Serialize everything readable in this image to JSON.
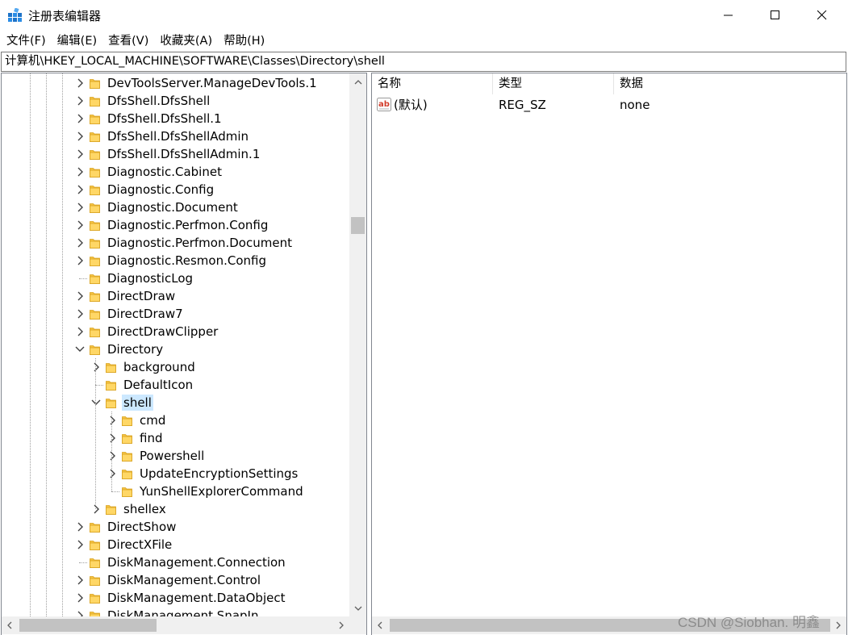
{
  "window": {
    "title": "注册表编辑器",
    "minimize_icon": "minimize-icon",
    "maximize_icon": "maximize-icon",
    "close_icon": "close-icon"
  },
  "menu": [
    {
      "label": "文件(F)"
    },
    {
      "label": "编辑(E)"
    },
    {
      "label": "查看(V)"
    },
    {
      "label": "收藏夹(A)"
    },
    {
      "label": "帮助(H)"
    }
  ],
  "address": "计算机\\HKEY_LOCAL_MACHINE\\SOFTWARE\\Classes\\Directory\\shell",
  "tree": [
    {
      "label": "DevToolsServer.ManageDevTools.1",
      "depth": 0,
      "expander": "collapsed"
    },
    {
      "label": "DfsShell.DfsShell",
      "depth": 0,
      "expander": "collapsed"
    },
    {
      "label": "DfsShell.DfsShell.1",
      "depth": 0,
      "expander": "collapsed"
    },
    {
      "label": "DfsShell.DfsShellAdmin",
      "depth": 0,
      "expander": "collapsed"
    },
    {
      "label": "DfsShell.DfsShellAdmin.1",
      "depth": 0,
      "expander": "collapsed"
    },
    {
      "label": "Diagnostic.Cabinet",
      "depth": 0,
      "expander": "collapsed"
    },
    {
      "label": "Diagnostic.Config",
      "depth": 0,
      "expander": "collapsed"
    },
    {
      "label": "Diagnostic.Document",
      "depth": 0,
      "expander": "collapsed"
    },
    {
      "label": "Diagnostic.Perfmon.Config",
      "depth": 0,
      "expander": "collapsed"
    },
    {
      "label": "Diagnostic.Perfmon.Document",
      "depth": 0,
      "expander": "collapsed"
    },
    {
      "label": "Diagnostic.Resmon.Config",
      "depth": 0,
      "expander": "collapsed"
    },
    {
      "label": "DiagnosticLog",
      "depth": 0,
      "expander": "none"
    },
    {
      "label": "DirectDraw",
      "depth": 0,
      "expander": "collapsed"
    },
    {
      "label": "DirectDraw7",
      "depth": 0,
      "expander": "collapsed"
    },
    {
      "label": "DirectDrawClipper",
      "depth": 0,
      "expander": "collapsed"
    },
    {
      "label": "Directory",
      "depth": 0,
      "expander": "expanded"
    },
    {
      "label": "background",
      "depth": 1,
      "expander": "collapsed"
    },
    {
      "label": "DefaultIcon",
      "depth": 1,
      "expander": "none"
    },
    {
      "label": "shell",
      "depth": 1,
      "expander": "expanded",
      "selected": true
    },
    {
      "label": "cmd",
      "depth": 2,
      "expander": "collapsed"
    },
    {
      "label": "find",
      "depth": 2,
      "expander": "collapsed"
    },
    {
      "label": "Powershell",
      "depth": 2,
      "expander": "collapsed"
    },
    {
      "label": "UpdateEncryptionSettings",
      "depth": 2,
      "expander": "collapsed"
    },
    {
      "label": "YunShellExplorerCommand",
      "depth": 2,
      "expander": "none"
    },
    {
      "label": "shellex",
      "depth": 1,
      "expander": "collapsed"
    },
    {
      "label": "DirectShow",
      "depth": 0,
      "expander": "collapsed"
    },
    {
      "label": "DirectXFile",
      "depth": 0,
      "expander": "collapsed"
    },
    {
      "label": "DiskManagement.Connection",
      "depth": 0,
      "expander": "none"
    },
    {
      "label": "DiskManagement.Control",
      "depth": 0,
      "expander": "collapsed"
    },
    {
      "label": "DiskManagement.DataObject",
      "depth": 0,
      "expander": "collapsed"
    },
    {
      "label": "DiskManagement.SnapIn",
      "depth": 0,
      "expander": "collapsed"
    }
  ],
  "list": {
    "columns": {
      "name": "名称",
      "type": "类型",
      "data": "数据"
    },
    "rows": [
      {
        "name": "(默认)",
        "type": "REG_SZ",
        "data": "none",
        "icon": "string-value-icon"
      }
    ]
  },
  "watermark": "CSDN @Siobhan. 明鑫",
  "colors": {
    "selection": "#cce8ff",
    "folder": "#f5c342",
    "accent": "#0078d7"
  }
}
